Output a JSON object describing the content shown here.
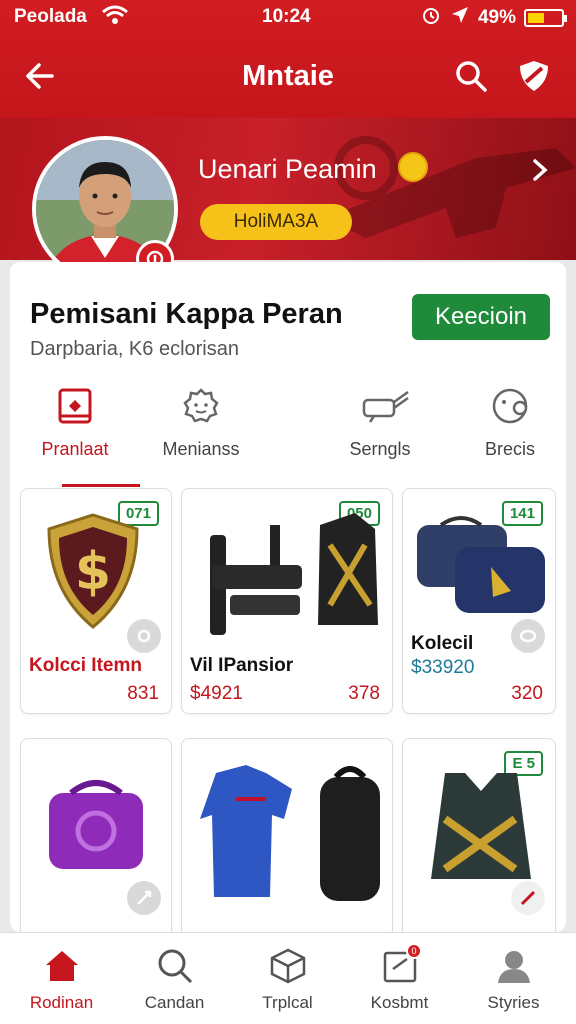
{
  "status": {
    "carrier": "Peolada",
    "time": "10:24",
    "battery": "49%",
    "battery_level": 0.49
  },
  "header": {
    "title": "Mntaie"
  },
  "profile": {
    "name": "Uenari Peamin",
    "tag": "HoliMA3A"
  },
  "card": {
    "title": "Pemisani Kappa Peran",
    "subtitle": "Darpbaria, K6 eclorisan",
    "action_label": "Keecioin"
  },
  "tabs": [
    {
      "label": "Pranlaat",
      "icon": "gift-card-icon",
      "active": true
    },
    {
      "label": "Menianss",
      "icon": "gear-icon",
      "active": false
    },
    {
      "label": "Serngls",
      "icon": "whistle-icon",
      "active": false
    },
    {
      "label": "Brecis",
      "icon": "smile-icon",
      "active": false
    }
  ],
  "products": [
    {
      "badge": "071",
      "label": "Kolcci Itemn",
      "price": "831",
      "image": "shield-emblem-icon"
    },
    {
      "badge": "050",
      "label": "Vil IPansior",
      "price_old": "$4921",
      "price": "378",
      "image": "rifle-and-vest-icon"
    },
    {
      "badge": "141",
      "label": "Kolecil",
      "price_old": "$33920",
      "price": "320",
      "image": "duffle-bags-icon"
    },
    {
      "badge": "",
      "label": "",
      "price": "",
      "image": "purple-bag-icon"
    },
    {
      "badge": "",
      "label": "",
      "price": "",
      "image": "jersey-and-backpack-icon"
    },
    {
      "badge": "E 5",
      "label": "",
      "price": "",
      "image": "tactical-vest-icon"
    }
  ],
  "bottom_nav": [
    {
      "label": "Rodinan",
      "icon": "home-icon",
      "active": true
    },
    {
      "label": "Candan",
      "icon": "search-icon",
      "active": false
    },
    {
      "label": "Trplcal",
      "icon": "box-icon",
      "active": false
    },
    {
      "label": "Kosbmt",
      "icon": "inbox-icon",
      "active": false,
      "notification": "0"
    },
    {
      "label": "Styries",
      "icon": "user-icon",
      "active": false
    }
  ],
  "colors": {
    "primary_red": "#c4161c",
    "accent_green": "#1f8a3a",
    "accent_yellow": "#f6c21a"
  }
}
